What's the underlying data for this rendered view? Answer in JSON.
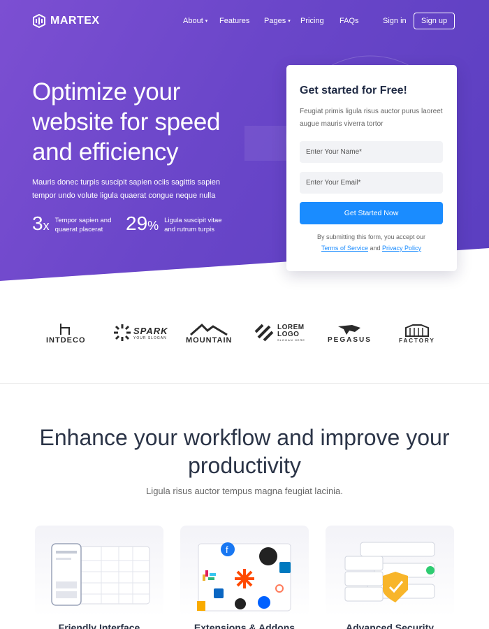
{
  "brand": {
    "name": "MARTEX"
  },
  "nav": {
    "about": "About",
    "features": "Features",
    "pages": "Pages",
    "pricing": "Pricing",
    "faqs": "FAQs",
    "signin": "Sign in",
    "signup": "Sign up"
  },
  "hero": {
    "title": "Optimize your website for speed and efficiency",
    "text": "Mauris donec turpis suscipit sapien ociis sagittis sapien tempor undo volute ligula quaerat congue neque nulla",
    "stats": [
      {
        "value": "3",
        "unit": "x",
        "label": "Tempor sapien and quaerat placerat"
      },
      {
        "value": "29",
        "unit": "%",
        "label": "Ligula suscipit vitae and rutrum turpis"
      }
    ]
  },
  "form": {
    "title": "Get started for Free!",
    "description": "Feugiat primis ligula risus auctor purus laoreet augue mauris viverra tortor",
    "name_placeholder": "Enter Your Name*",
    "email_placeholder": "Enter Your Email*",
    "button": "Get Started Now",
    "terms_prefix": "By submitting this form, you accept our",
    "terms_link": "Terms of Service",
    "terms_and": "and",
    "privacy_link": "Privacy Policy"
  },
  "brands": [
    {
      "name": "INTDECO"
    },
    {
      "name": "SPARK",
      "sub": "YOUR SLOGAN"
    },
    {
      "name": "MOUNTAIN"
    },
    {
      "name": "LOREM LOGO",
      "sub": "SLOGAN HERE"
    },
    {
      "name": "PEGASUS"
    },
    {
      "name": "FACTORY"
    }
  ],
  "features": {
    "title": "Enhance your workflow and improve your productivity",
    "subtitle": "Ligula risus auctor tempus magna feugiat lacinia.",
    "cards": [
      {
        "title": "Friendly Interface"
      },
      {
        "title": "Extensions & Addons"
      },
      {
        "title": "Advanced Security"
      }
    ]
  },
  "colors": {
    "hero_start": "#7c4fd2",
    "hero_end": "#5a3ec0",
    "accent": "#1a8cff",
    "heading": "#2b3447"
  }
}
